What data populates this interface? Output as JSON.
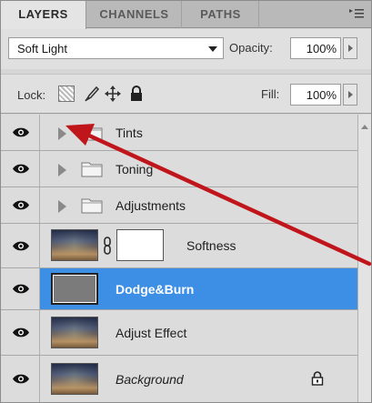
{
  "tabs": [
    {
      "label": "LAYERS",
      "active": true
    },
    {
      "label": "CHANNELS",
      "active": false
    },
    {
      "label": "PATHS",
      "active": false
    }
  ],
  "blend_mode": "Soft Light",
  "opacity": {
    "label": "Opacity:",
    "value": "100%"
  },
  "lock": {
    "label": "Lock:"
  },
  "fill": {
    "label": "Fill:",
    "value": "100%"
  },
  "layers": [
    {
      "name": "Tints",
      "type": "group"
    },
    {
      "name": "Toning",
      "type": "group"
    },
    {
      "name": "Adjustments",
      "type": "group"
    },
    {
      "name": "Softness",
      "type": "masked-adjustment"
    },
    {
      "name": "Dodge&Burn",
      "type": "layer",
      "selected": true
    },
    {
      "name": "Adjust Effect",
      "type": "layer"
    },
    {
      "name": "Background",
      "type": "background",
      "locked": true
    }
  ],
  "colors": {
    "selection": "#3d8fe6",
    "arrow": "#c0151b"
  },
  "icons": {
    "panel_menu": "panel-menu-icon",
    "eye": "eye-icon",
    "folder": "folder-icon",
    "expand": "expand-triangle-icon",
    "chain": "chain-link-icon",
    "lock": "lock-icon"
  }
}
